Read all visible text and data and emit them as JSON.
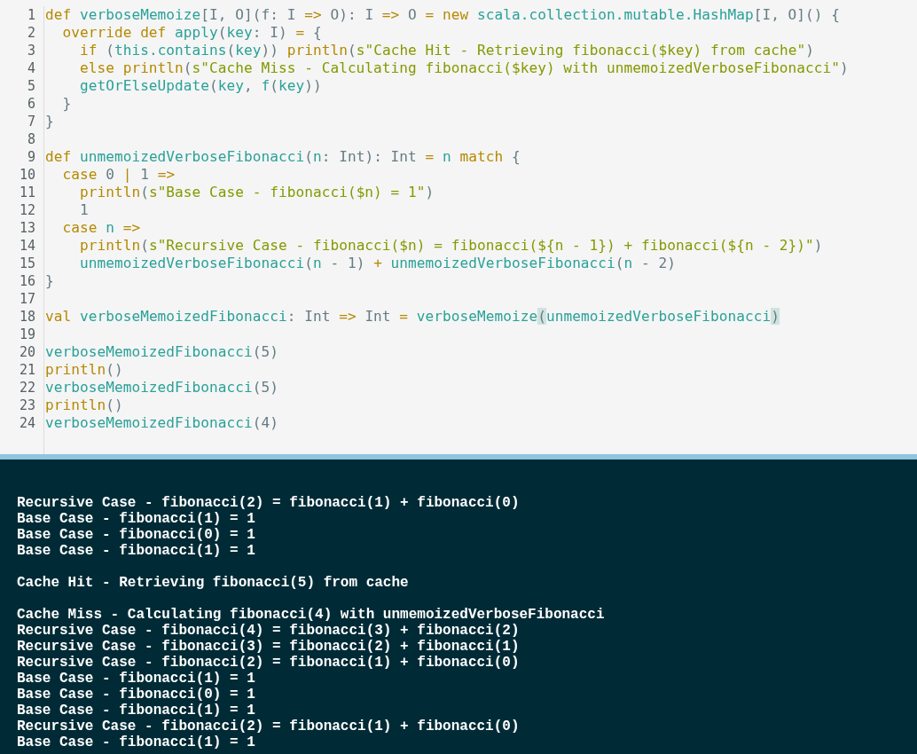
{
  "editor": {
    "lines": [
      {
        "number": "1",
        "tokens": [
          {
            "text": "def ",
            "kind": "keyword"
          },
          {
            "text": "verboseMemoize",
            "kind": "identifier"
          },
          {
            "text": "[I, O](f: I ",
            "kind": "plain"
          },
          {
            "text": "=> ",
            "kind": "keyword"
          },
          {
            "text": "O): I ",
            "kind": "plain"
          },
          {
            "text": "=> ",
            "kind": "keyword"
          },
          {
            "text": "O ",
            "kind": "plain"
          },
          {
            "text": "= new ",
            "kind": "keyword"
          },
          {
            "text": "scala.collection.mutable.HashMap",
            "kind": "identifier"
          },
          {
            "text": "[I, O]() {",
            "kind": "plain"
          }
        ]
      },
      {
        "number": "2",
        "tokens": [
          {
            "text": "  override def ",
            "kind": "keyword"
          },
          {
            "text": "apply",
            "kind": "identifier"
          },
          {
            "text": "(",
            "kind": "plain"
          },
          {
            "text": "key",
            "kind": "identifier"
          },
          {
            "text": ": I) ",
            "kind": "plain"
          },
          {
            "text": "= ",
            "kind": "keyword"
          },
          {
            "text": "{",
            "kind": "plain"
          }
        ]
      },
      {
        "number": "3",
        "tokens": [
          {
            "text": "    if ",
            "kind": "keyword"
          },
          {
            "text": "(",
            "kind": "plain"
          },
          {
            "text": "this.contains",
            "kind": "identifier"
          },
          {
            "text": "(",
            "kind": "plain"
          },
          {
            "text": "key",
            "kind": "identifier"
          },
          {
            "text": ")) ",
            "kind": "plain"
          },
          {
            "text": "println",
            "kind": "keyword"
          },
          {
            "text": "(",
            "kind": "plain"
          },
          {
            "text": "s\"Cache Hit - Retrieving fibonacci($key) from cache\"",
            "kind": "string"
          },
          {
            "text": ")",
            "kind": "plain"
          }
        ]
      },
      {
        "number": "4",
        "tokens": [
          {
            "text": "    else println",
            "kind": "keyword"
          },
          {
            "text": "(",
            "kind": "plain"
          },
          {
            "text": "s\"Cache Miss - Calculating fibonacci($key) with unmemoizedVerboseFibonacci\"",
            "kind": "string"
          },
          {
            "text": ")",
            "kind": "plain"
          }
        ]
      },
      {
        "number": "5",
        "tokens": [
          {
            "text": "    getOrElseUpdate",
            "kind": "identifier"
          },
          {
            "text": "(",
            "kind": "plain"
          },
          {
            "text": "key",
            "kind": "identifier"
          },
          {
            "text": ", ",
            "kind": "plain"
          },
          {
            "text": "f",
            "kind": "identifier"
          },
          {
            "text": "(",
            "kind": "plain"
          },
          {
            "text": "key",
            "kind": "identifier"
          },
          {
            "text": "))",
            "kind": "plain"
          }
        ]
      },
      {
        "number": "6",
        "tokens": [
          {
            "text": "  }",
            "kind": "plain"
          }
        ]
      },
      {
        "number": "7",
        "tokens": [
          {
            "text": "}",
            "kind": "plain"
          }
        ]
      },
      {
        "number": "8"
      },
      {
        "number": "9",
        "tokens": [
          {
            "text": "def ",
            "kind": "keyword"
          },
          {
            "text": "unmemoizedVerboseFibonacci",
            "kind": "identifier"
          },
          {
            "text": "(",
            "kind": "plain"
          },
          {
            "text": "n",
            "kind": "identifier"
          },
          {
            "text": ": Int): Int ",
            "kind": "plain"
          },
          {
            "text": "= ",
            "kind": "keyword"
          },
          {
            "text": "n ",
            "kind": "identifier"
          },
          {
            "text": "match ",
            "kind": "keyword"
          },
          {
            "text": "{",
            "kind": "plain"
          }
        ]
      },
      {
        "number": "10",
        "tokens": [
          {
            "text": "  case ",
            "kind": "keyword"
          },
          {
            "text": "0 ",
            "kind": "plain"
          },
          {
            "text": "| ",
            "kind": "keyword"
          },
          {
            "text": "1 ",
            "kind": "plain"
          },
          {
            "text": "=>",
            "kind": "keyword"
          }
        ]
      },
      {
        "number": "11",
        "tokens": [
          {
            "text": "    println",
            "kind": "keyword"
          },
          {
            "text": "(",
            "kind": "plain"
          },
          {
            "text": "s\"Base Case - fibonacci($n) = 1\"",
            "kind": "string"
          },
          {
            "text": ")",
            "kind": "plain"
          }
        ]
      },
      {
        "number": "12",
        "tokens": [
          {
            "text": "    1",
            "kind": "plain"
          }
        ]
      },
      {
        "number": "13",
        "tokens": [
          {
            "text": "  case ",
            "kind": "keyword"
          },
          {
            "text": "n ",
            "kind": "identifier"
          },
          {
            "text": "=>",
            "kind": "keyword"
          }
        ]
      },
      {
        "number": "14",
        "tokens": [
          {
            "text": "    println",
            "kind": "keyword"
          },
          {
            "text": "(",
            "kind": "plain"
          },
          {
            "text": "s\"Recursive Case - fibonacci($n) = fibonacci(${n - 1}) + fibonacci(${n - 2})\"",
            "kind": "string"
          },
          {
            "text": ")",
            "kind": "plain"
          }
        ]
      },
      {
        "number": "15",
        "tokens": [
          {
            "text": "    unmemoizedVerboseFibonacci",
            "kind": "identifier"
          },
          {
            "text": "(",
            "kind": "plain"
          },
          {
            "text": "n ",
            "kind": "identifier"
          },
          {
            "text": "- 1) ",
            "kind": "plain"
          },
          {
            "text": "+ ",
            "kind": "keyword"
          },
          {
            "text": "unmemoizedVerboseFibonacci",
            "kind": "identifier"
          },
          {
            "text": "(",
            "kind": "plain"
          },
          {
            "text": "n ",
            "kind": "identifier"
          },
          {
            "text": "- 2)",
            "kind": "plain"
          }
        ]
      },
      {
        "number": "16",
        "tokens": [
          {
            "text": "}",
            "kind": "plain"
          }
        ]
      },
      {
        "number": "17"
      },
      {
        "number": "18",
        "tokens": [
          {
            "text": "val ",
            "kind": "keyword"
          },
          {
            "text": "verboseMemoizedFibonacci",
            "kind": "identifier"
          },
          {
            "text": ": Int ",
            "kind": "plain"
          },
          {
            "text": "=> ",
            "kind": "keyword"
          },
          {
            "text": "Int ",
            "kind": "plain"
          },
          {
            "text": "= ",
            "kind": "keyword"
          },
          {
            "text": "verboseMemoize",
            "kind": "identifier"
          },
          {
            "text": "(",
            "kind": "bracket-match"
          },
          {
            "text": "unmemoizedVerboseFibonacci",
            "kind": "identifier"
          },
          {
            "text": ")",
            "kind": "bracket-match"
          }
        ]
      },
      {
        "number": "19"
      },
      {
        "number": "20",
        "tokens": [
          {
            "text": "verboseMemoizedFibonacci",
            "kind": "identifier"
          },
          {
            "text": "(5)",
            "kind": "plain"
          }
        ]
      },
      {
        "number": "21",
        "tokens": [
          {
            "text": "println",
            "kind": "keyword"
          },
          {
            "text": "()",
            "kind": "plain"
          }
        ]
      },
      {
        "number": "22",
        "tokens": [
          {
            "text": "verboseMemoizedFibonacci",
            "kind": "identifier"
          },
          {
            "text": "(5)",
            "kind": "plain"
          }
        ]
      },
      {
        "number": "23",
        "tokens": [
          {
            "text": "println",
            "kind": "keyword"
          },
          {
            "text": "()",
            "kind": "plain"
          }
        ]
      },
      {
        "number": "24",
        "tokens": [
          {
            "text": "verboseMemoizedFibonacci",
            "kind": "identifier"
          },
          {
            "text": "(4)",
            "kind": "plain"
          }
        ]
      }
    ]
  },
  "console": {
    "blocks": [
      [
        "Recursive Case - fibonacci(2) = fibonacci(1) + fibonacci(0)",
        "Base Case - fibonacci(1) = 1",
        "Base Case - fibonacci(0) = 1",
        "Base Case - fibonacci(1) = 1"
      ],
      [
        "Cache Hit - Retrieving fibonacci(5) from cache"
      ],
      [
        "Cache Miss - Calculating fibonacci(4) with unmemoizedVerboseFibonacci",
        "Recursive Case - fibonacci(4) = fibonacci(3) + fibonacci(2)",
        "Recursive Case - fibonacci(3) = fibonacci(2) + fibonacci(1)",
        "Recursive Case - fibonacci(2) = fibonacci(1) + fibonacci(0)",
        "Base Case - fibonacci(1) = 1",
        "Base Case - fibonacci(0) = 1",
        "Base Case - fibonacci(1) = 1",
        "Recursive Case - fibonacci(2) = fibonacci(1) + fibonacci(0)",
        "Base Case - fibonacci(1) = 1"
      ]
    ]
  }
}
